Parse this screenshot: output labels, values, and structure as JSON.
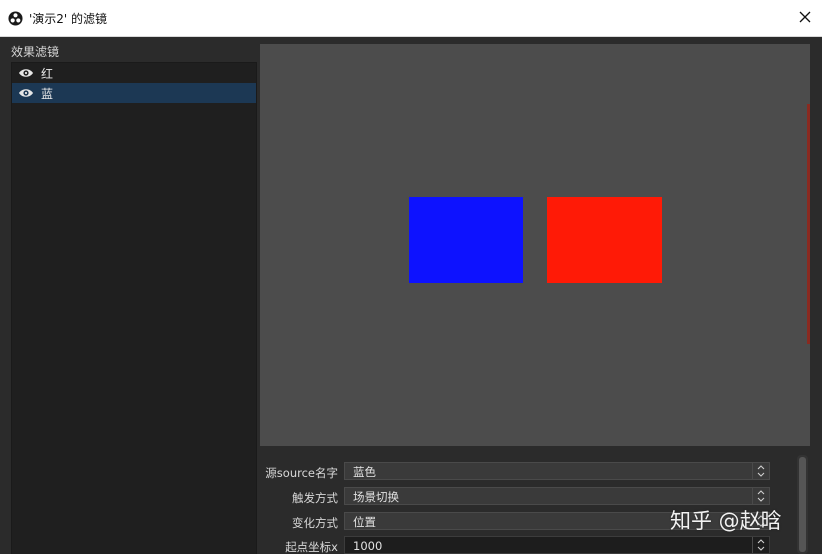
{
  "window": {
    "title": "'演示2' 的滤镜",
    "app_icon": "obs-icon",
    "close_icon": "close-icon"
  },
  "filters": {
    "section_label": "效果滤镜",
    "items": [
      {
        "label": "红",
        "icon": "eye-icon",
        "selected": false
      },
      {
        "label": "蓝",
        "icon": "eye-icon",
        "selected": true
      }
    ]
  },
  "preview": {
    "background": "#4c4c4c",
    "blue_rect_color": "#0d12ff",
    "red_rect_color": "#ff1a06"
  },
  "properties": {
    "source_name": {
      "label": "源source名字",
      "value": "蓝色"
    },
    "trigger": {
      "label": "触发方式",
      "value": "场景切换"
    },
    "change_mode": {
      "label": "变化方式",
      "value": "位置"
    },
    "start_x": {
      "label": "起点坐标x",
      "value": "1000"
    }
  },
  "watermark": "知乎 @赵晗"
}
